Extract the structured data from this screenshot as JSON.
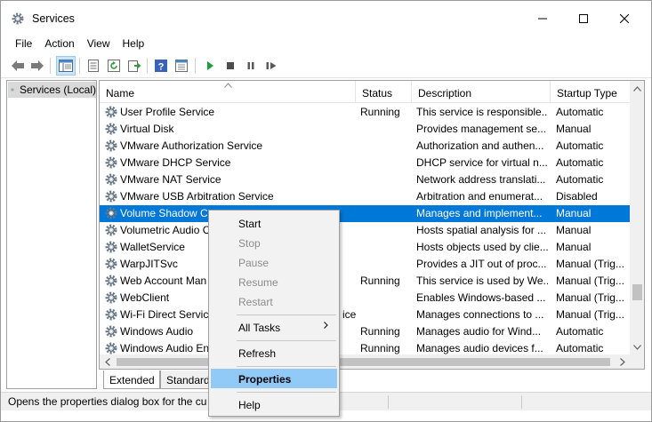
{
  "window": {
    "title": "Services"
  },
  "menu": [
    "File",
    "Action",
    "View",
    "Help"
  ],
  "left_pane": {
    "item": "Services (Local)"
  },
  "columns": {
    "name": "Name",
    "status": "Status",
    "description": "Description",
    "startup": "Startup Type"
  },
  "services": [
    {
      "name": "User Profile Service",
      "status": "Running",
      "description": "This service is responsible...",
      "startup": "Automatic"
    },
    {
      "name": "Virtual Disk",
      "status": "",
      "description": "Provides management se...",
      "startup": "Manual"
    },
    {
      "name": "VMware Authorization Service",
      "status": "",
      "description": "Authorization and authen...",
      "startup": "Automatic"
    },
    {
      "name": "VMware DHCP Service",
      "status": "",
      "description": "DHCP service for virtual n...",
      "startup": "Automatic"
    },
    {
      "name": "VMware NAT Service",
      "status": "",
      "description": "Network address translati...",
      "startup": "Automatic"
    },
    {
      "name": "VMware USB Arbitration Service",
      "status": "",
      "description": "Arbitration and enumerat...",
      "startup": "Disabled"
    },
    {
      "name": "Volume Shadow Co",
      "status": "",
      "description": "Manages and implement...",
      "startup": "Manual"
    },
    {
      "name": "Volumetric Audio C",
      "status": "",
      "description": "Hosts spatial analysis for ...",
      "startup": "Manual"
    },
    {
      "name": "WalletService",
      "status": "",
      "description": "Hosts objects used by clie...",
      "startup": "Manual"
    },
    {
      "name": "WarpJITSvc",
      "status": "",
      "description": "Provides a JIT out of proc...",
      "startup": "Manual (Trig..."
    },
    {
      "name": "Web Account Man",
      "status": "Running",
      "description": "This service is used by We...",
      "startup": "Manual (Trig..."
    },
    {
      "name": "WebClient",
      "status": "",
      "description": "Enables Windows-based ...",
      "startup": "Manual (Trig..."
    },
    {
      "name": "Wi-Fi Direct Service",
      "status": "",
      "description": "Manages connections to ...",
      "startup": "Manual (Trig..."
    },
    {
      "name": "Windows Audio",
      "status": "Running",
      "description": "Manages audio for Wind...",
      "startup": "Automatic"
    },
    {
      "name": "Windows Audio En",
      "status": "Running",
      "description": "Manages audio devices f...",
      "startup": "Automatic"
    }
  ],
  "wifi_suffix": "ice",
  "tabs": [
    "Extended",
    "Standard"
  ],
  "status_bar": "Opens the properties dialog box for the cu",
  "context_menu": {
    "start": "Start",
    "stop": "Stop",
    "pause": "Pause",
    "resume": "Resume",
    "restart": "Restart",
    "all_tasks": "All Tasks",
    "refresh": "Refresh",
    "properties": "Properties",
    "help": "Help"
  },
  "colors": {
    "selection": "#0078d7",
    "menu_hover": "#91c9f7"
  }
}
